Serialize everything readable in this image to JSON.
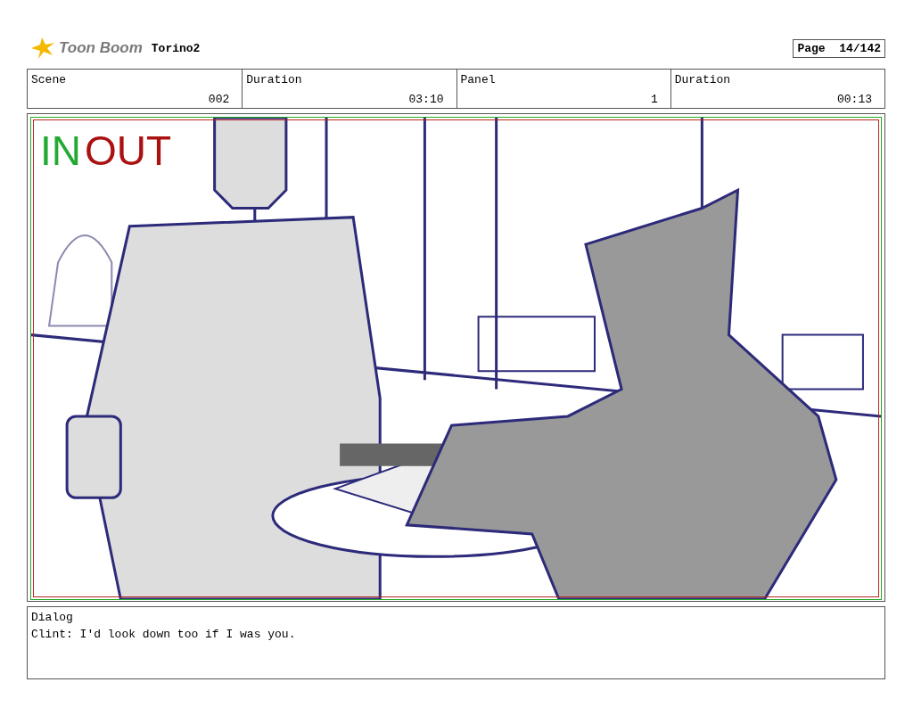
{
  "header": {
    "logo": "Toon Boom",
    "project": "Torino2",
    "page": "Page  14/142"
  },
  "info": [
    {
      "label": "Scene",
      "value": "002"
    },
    {
      "label": "Duration",
      "value": "03:10"
    },
    {
      "label": "Panel",
      "value": "1"
    },
    {
      "label": "Duration",
      "value": "00:13"
    }
  ],
  "panel": {
    "in_marker": "IN",
    "out_marker": "OUT"
  },
  "dialog": {
    "label": "Dialog",
    "text": "Clint: I'd look down too if I was you."
  }
}
